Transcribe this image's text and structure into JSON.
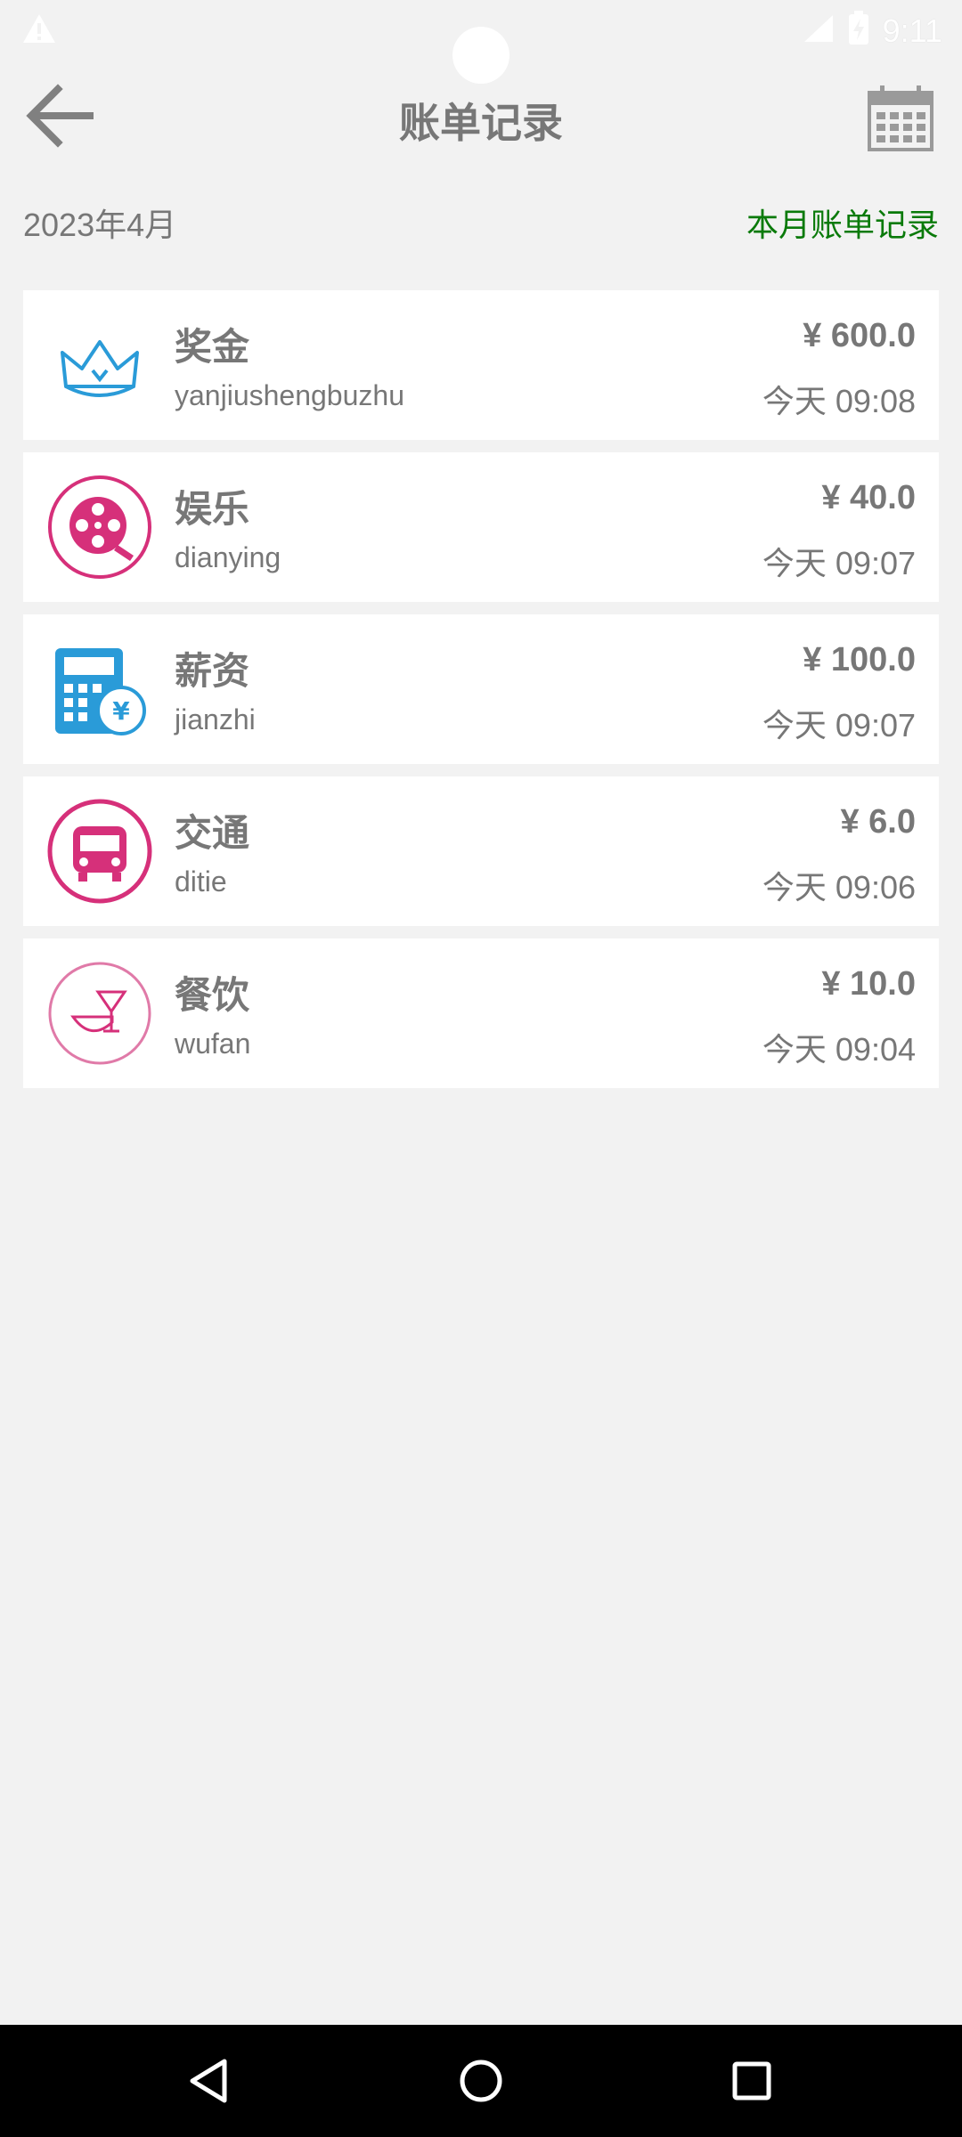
{
  "status_bar": {
    "time": "9:11",
    "icons": [
      "warning-icon",
      "signal-icon",
      "battery-charging-icon"
    ]
  },
  "toolbar": {
    "title": "账单记录",
    "back_icon": "arrow-left-icon",
    "calendar_icon": "calendar-icon"
  },
  "sub_header": {
    "month": "2023年4月",
    "link": "本月账单记录"
  },
  "bills": [
    {
      "category": "奖金",
      "note": "yanjiushengbuzhu",
      "amount": "¥ 600.0",
      "time": "今天 09:08",
      "icon": "crown-icon"
    },
    {
      "category": "娱乐",
      "note": "dianying",
      "amount": "¥ 40.0",
      "time": "今天 09:07",
      "icon": "film-reel-icon"
    },
    {
      "category": "薪资",
      "note": "jianzhi",
      "amount": "¥ 100.0",
      "time": "今天 09:07",
      "icon": "calculator-yuan-icon"
    },
    {
      "category": "交通",
      "note": "ditie",
      "amount": "¥ 6.0",
      "time": "今天 09:06",
      "icon": "bus-icon"
    },
    {
      "category": "餐饮",
      "note": "wufan",
      "amount": "¥ 10.0",
      "time": "今天 09:04",
      "icon": "dining-icon"
    }
  ],
  "colors": {
    "background": "#f2f2f2",
    "accent_green": "#0a7a0a",
    "pink": "#d6307a",
    "blue": "#2a9bd8"
  },
  "nav_bar": {
    "icons": [
      "nav-back-icon",
      "nav-home-icon",
      "nav-recent-icon"
    ]
  }
}
